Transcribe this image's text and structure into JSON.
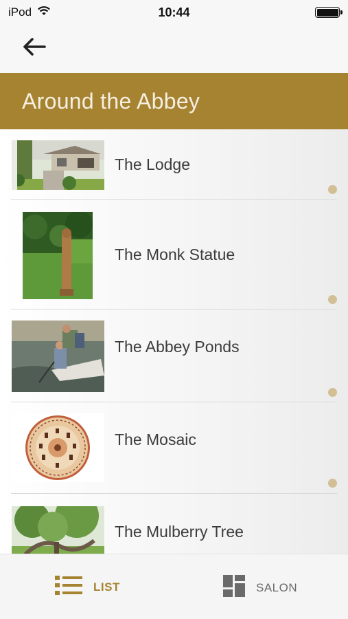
{
  "status_bar": {
    "carrier": "iPod",
    "time": "10:44",
    "wifi_icon": "wifi-icon",
    "battery_icon": "battery-icon"
  },
  "nav": {
    "back_icon": "arrow-left-icon"
  },
  "header": {
    "title": "Around the Abbey"
  },
  "list": {
    "items": [
      {
        "label": "The Lodge"
      },
      {
        "label": "The Monk Statue"
      },
      {
        "label": "The Abbey Ponds"
      },
      {
        "label": "The Mosaic"
      },
      {
        "label": "The Mulberry Tree"
      }
    ]
  },
  "tab_bar": {
    "tabs": [
      {
        "label": "LIST",
        "icon": "list-icon",
        "active": true
      },
      {
        "label": "SALON",
        "icon": "grid-icon",
        "active": false
      }
    ]
  },
  "colors": {
    "accent": "#a68331",
    "dot": "#d3bf95",
    "header_text": "#f6efe2"
  }
}
